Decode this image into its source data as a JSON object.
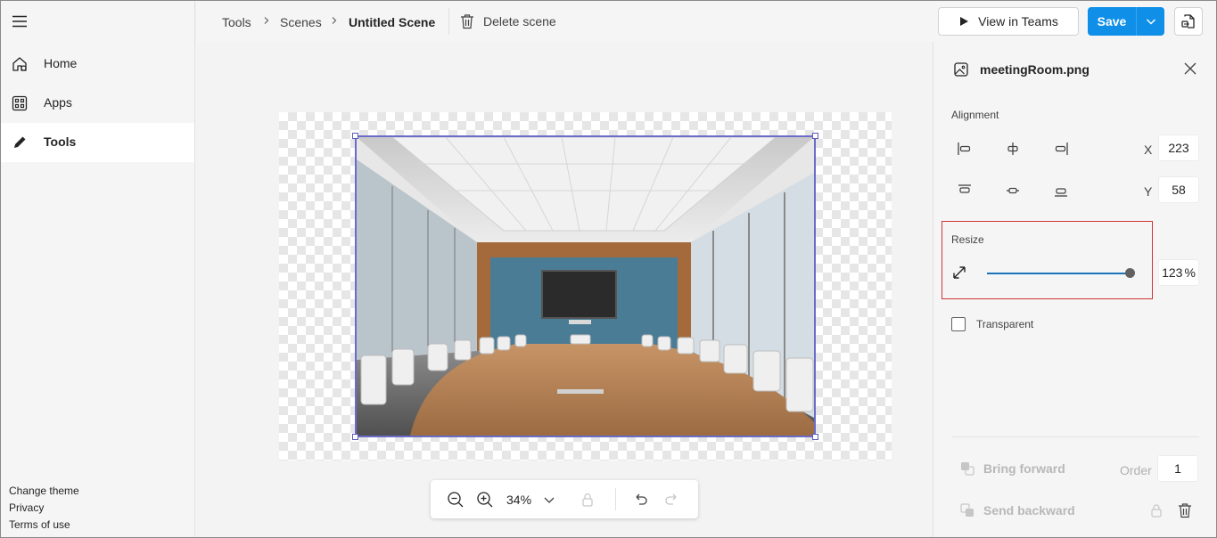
{
  "sidebar": {
    "items": [
      {
        "label": "Home",
        "icon": "home-icon"
      },
      {
        "label": "Apps",
        "icon": "apps-icon"
      },
      {
        "label": "Tools",
        "icon": "pencil-icon",
        "active": true
      }
    ],
    "footer": [
      "Change theme",
      "Privacy",
      "Terms of use"
    ]
  },
  "topbar": {
    "breadcrumb": [
      "Tools",
      "Scenes",
      "Untitled Scene"
    ],
    "delete_label": "Delete scene",
    "view_in_teams_label": "View in Teams",
    "save_label": "Save",
    "accent_color": "#0f8fe8"
  },
  "canvas": {
    "zoom": "34%"
  },
  "panel": {
    "file_name": "meetingRoom.png",
    "alignment_label": "Alignment",
    "x_label": "X",
    "x_value": "223",
    "y_label": "Y",
    "y_value": "58",
    "resize_label": "Resize",
    "resize_value": "123",
    "resize_unit": "%",
    "resize_fraction": 1.0,
    "transparent_label": "Transparent",
    "transparent_checked": false,
    "bring_forward_label": "Bring forward",
    "send_backward_label": "Send backward",
    "order_label": "Order",
    "order_value": "1"
  }
}
